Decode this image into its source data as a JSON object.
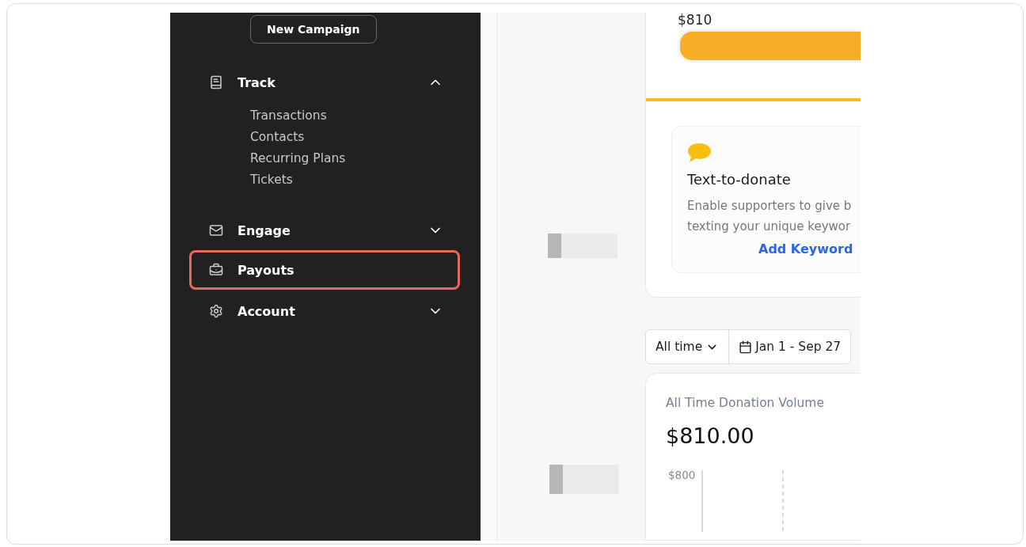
{
  "sidebar": {
    "new_campaign_button": "New Campaign",
    "items": [
      {
        "label": "Track",
        "expanded": true,
        "highlighted": false,
        "children": [
          {
            "label": "Transactions"
          },
          {
            "label": "Contacts"
          },
          {
            "label": "Recurring Plans"
          },
          {
            "label": "Tickets"
          }
        ]
      },
      {
        "label": "Engage",
        "expanded": false,
        "highlighted": false
      },
      {
        "label": "Payouts",
        "highlighted": true
      },
      {
        "label": "Account",
        "expanded": false,
        "highlighted": false
      }
    ]
  },
  "goal_card": {
    "amount": "$810",
    "progress": {
      "level": 1
    }
  },
  "text_to_donate": {
    "title": "Text-to-donate",
    "description_lines": [
      "Enable supporters to give b",
      "texting your unique keywor"
    ],
    "link": "Add Keyword"
  },
  "filters": {
    "range": "All time",
    "dates": "Jan 1 - Sep 27"
  },
  "volume_card": {
    "title": "All Time Donation Volume",
    "amount": "$810.00",
    "y_tick": "$800"
  }
}
